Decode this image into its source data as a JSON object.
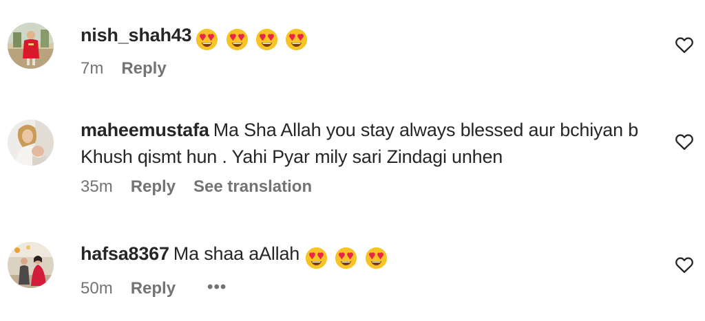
{
  "comments": [
    {
      "username": "nish_shah43",
      "text": "",
      "emojis": 4,
      "time": "7m",
      "reply_label": "Reply",
      "translate_label": "",
      "has_more": false
    },
    {
      "username": "maheemustafa",
      "text": "Ma Sha Allah you stay always blessed aur bchiyan b Khush qismt hun . Yahi Pyar mily sari Zindagi unhen",
      "emojis": 0,
      "time": "35m",
      "reply_label": "Reply",
      "translate_label": "See translation",
      "has_more": false
    },
    {
      "username": "hafsa8367",
      "text": "Ma shaa aAllah",
      "emojis": 3,
      "time": "50m",
      "reply_label": "Reply",
      "translate_label": "",
      "has_more": true,
      "more_label": "•••"
    }
  ],
  "icons": {
    "emoji": "smiling-face-with-heart-eyes-icon",
    "like": "heart-outline-icon",
    "more": "more-options-icon"
  },
  "colors": {
    "text": "#262626",
    "meta": "#737373",
    "emoji_face": "#F7C325",
    "emoji_heart": "#E8264A"
  }
}
